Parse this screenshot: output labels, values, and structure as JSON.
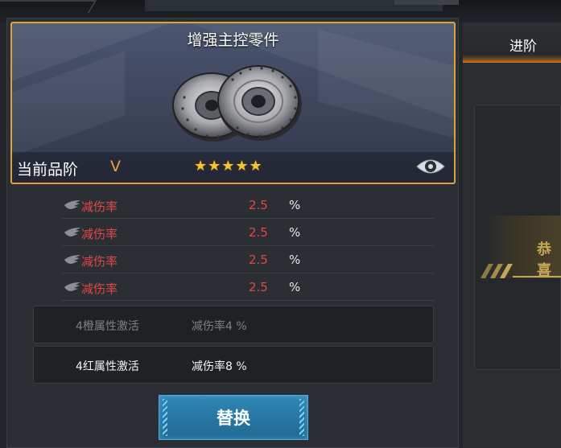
{
  "item": {
    "name": "增强主控零件",
    "grade_label": "当前品阶",
    "grade_value": "V",
    "stars": "★★★★★",
    "image_icon": "brake-disc-icon",
    "view_icon": "eye-icon"
  },
  "stats": [
    {
      "name": "减伤率",
      "value": "2.5",
      "unit": "%"
    },
    {
      "name": "减伤率",
      "value": "2.5",
      "unit": "%"
    },
    {
      "name": "减伤率",
      "value": "2.5",
      "unit": "%"
    },
    {
      "name": "减伤率",
      "value": "2.5",
      "unit": "%"
    }
  ],
  "set_bonuses": [
    {
      "name": "4橙属性激活",
      "desc": "减伤率4 %",
      "active": false
    },
    {
      "name": "4红属性激活",
      "desc": "减伤率8 %",
      "active": true
    }
  ],
  "replace_button": "替换",
  "right_panel": {
    "tab_label": "进阶",
    "banner_text": "恭喜"
  },
  "colors": {
    "accent_orange": "#e1a03a",
    "stat_red": "#e24747",
    "button_blue": "#2f86b4",
    "star_gold": "#f7c23a"
  }
}
